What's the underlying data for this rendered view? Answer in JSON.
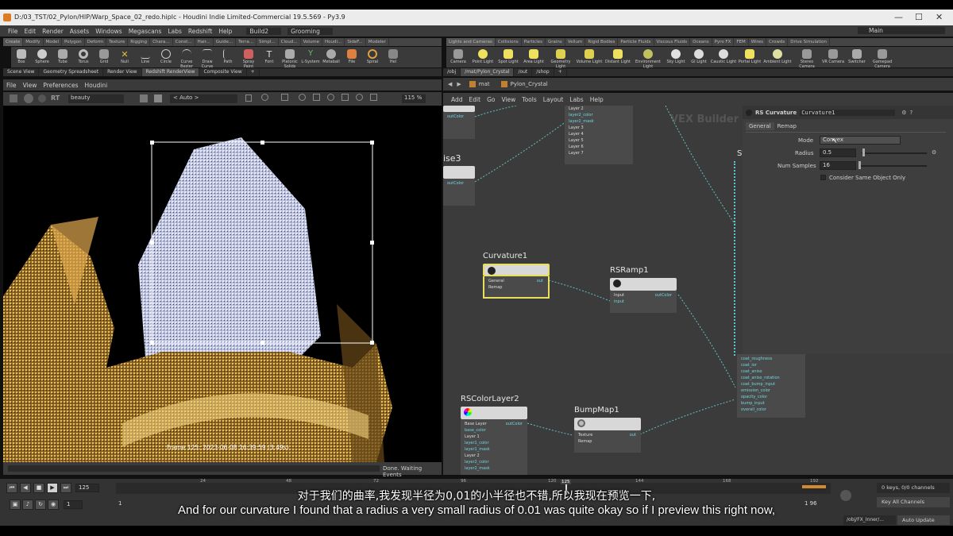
{
  "window": {
    "title": "D:/03_TST/02_Pylon/HIP/Warp_Space_02_redo.hiplc - Houdini Indie Limited-Commercial 19.5.569 - Py3.9",
    "min": "—",
    "max": "☐",
    "close": "✕"
  },
  "menu": [
    "File",
    "Edit",
    "Render",
    "Assets",
    "Windows",
    "Megascans",
    "Labs",
    "Redshift",
    "Help"
  ],
  "desktop": "Build2",
  "context": "Grooming",
  "main_label": "Main",
  "shelf_tabs_left": [
    "Create",
    "Modify",
    "Model",
    "Polygon",
    "Deform",
    "Texture",
    "Rigging",
    "Chara...",
    "Const...",
    "Hair...",
    "Guide...",
    "Terra...",
    "Simpl...",
    "Cloud...",
    "Volume",
    "Houdi...",
    "SideF...",
    "Modeler"
  ],
  "shelf_tools_left": [
    "Box",
    "Sphere",
    "Tube",
    "Torus",
    "Grid",
    "Null",
    "Line",
    "Circle",
    "Curve Bezier",
    "Draw Curve",
    "Path",
    "Spray Paint",
    "Font",
    "Platonic Solids",
    "L-System",
    "Metaball",
    "File",
    "Spiral",
    "Hel"
  ],
  "shelf_tabs_right": [
    "Lights and Cameras",
    "Collisions",
    "Particles",
    "Grains",
    "Vellum",
    "Rigid Bodies",
    "Particle Fluids",
    "Viscous Fluids",
    "Oceans",
    "Pyro FX",
    "FEM",
    "Wires",
    "Crowds",
    "Drive Simulation"
  ],
  "shelf_tools_right": [
    "Camera",
    "Point Light",
    "Spot Light",
    "Area Light",
    "Geometry Light",
    "Volume Light",
    "Distant Light",
    "Environment Light",
    "Sky Light",
    "GI Light",
    "Caustic Light",
    "Portal Light",
    "Ambient Light",
    "Stereo Camera",
    "VR Camera",
    "Switcher",
    "Gamepad Camera"
  ],
  "pane_tabs_left": [
    "Scene View",
    "Geometry Spreadsheet",
    "Render View",
    "Redshift RenderView",
    "Composite View"
  ],
  "pane_tabs_right": [
    "/obj",
    "/mat/Pylon_Crystal",
    "/out",
    "/shop"
  ],
  "rv_menu": [
    "File",
    "View",
    "Preferences",
    "Houdini"
  ],
  "rv_toolbar": {
    "aov": "beauty",
    "auto": "< Auto >",
    "zoom": "115 %",
    "rt": "RT"
  },
  "viewport": {
    "frame_info": "Frame 125: 2023-06-08 16:39:59 (3.49s)",
    "status": "Done. Waiting Events"
  },
  "path": {
    "root": "mat",
    "node": "Pylon_Crystal"
  },
  "net_menu": [
    "Add",
    "Edit",
    "Go",
    "View",
    "Tools",
    "Layout",
    "Labs",
    "Help"
  ],
  "net_watermark": "VEX Builder",
  "nodes": {
    "curvature": {
      "name": "Curvature1",
      "inputs": [
        "General",
        "Remap"
      ],
      "out": "out"
    },
    "rsramp": {
      "name": "RSRamp1",
      "inputs": [
        "Input",
        "input"
      ],
      "out": "outColor"
    },
    "colorlayer": {
      "name": "RSColorLayer2",
      "inputs": [
        "Base Layer",
        "base_color",
        "Layer 1",
        "layer1_color",
        "layer1_mask",
        "Layer 2",
        "layer2_color",
        "layer2_mask"
      ],
      "out": "outColor"
    },
    "bumpmap": {
      "name": "BumpMap1",
      "inputs": [
        "Texture",
        "Remap"
      ],
      "out": "out"
    },
    "noise3": {
      "name": "ise3",
      "out": "outColor"
    },
    "topnode": {
      "inputs": [
        "Layer 2",
        "layer2_color",
        "layer2_mask",
        "Layer 3",
        "Layer 4",
        "Layer 5",
        "Layer 6",
        "Layer 7"
      ]
    },
    "topleft": {
      "out": "outColor"
    },
    "material": {
      "name": "St",
      "ports": [
        "coat_roughness",
        "coat_ior",
        "coat_aniso",
        "coat_aniso_rotation",
        "coat_bump_input",
        "emission_color",
        "opacity_color",
        "bump_input",
        "overall_color"
      ]
    }
  },
  "params": {
    "type": "RS Curvature",
    "name": "Curvature1",
    "tabs": [
      "General",
      "Remap"
    ],
    "mode_label": "Mode",
    "mode_value": "Convex",
    "radius_label": "Radius",
    "radius_value": "0.5",
    "samples_label": "Num Samples",
    "samples_value": "16",
    "same_object": "Consider Same Object Only"
  },
  "timeline": {
    "frame": "125",
    "start": "1",
    "end": "1",
    "end2": "1 96",
    "ticks": [
      "24",
      "48",
      "72",
      "96",
      "120",
      "144",
      "168",
      "192"
    ],
    "current": "125",
    "keys": "0 keys, 0/0 channels",
    "key_all": "Key All Channels",
    "auto_update": "Auto Update",
    "path": "/obj/FX_Inner/..."
  },
  "subtitles": {
    "zh": "对于我们的曲率,我发现半径为0,01的小半径也不错,所以我现在预览一下,",
    "en": "And for our curvature I found that a radius a very small radius of 0.01 was quite okay so if I preview this right now,"
  },
  "colors": {
    "accent": "#e07a20",
    "port": "#5ac8d0",
    "selected": "#e8e05a"
  }
}
